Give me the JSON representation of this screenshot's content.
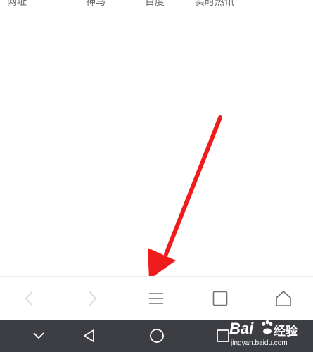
{
  "shortcuts": [
    "网址",
    "神马",
    "百度",
    "实时热讯"
  ],
  "toolbar": {
    "back_icon": "chevron-left-icon",
    "forward_icon": "chevron-right-icon",
    "menu_icon": "menu-icon",
    "tabs_icon": "tabs-icon",
    "home_icon": "home-icon"
  },
  "nav_bar": {
    "collapse_icon": "chevron-down-icon",
    "back_icon": "triangle-back-icon",
    "home_icon": "circle-home-icon",
    "recent_icon": "square-recent-icon"
  },
  "watermark": {
    "brand": "Bai",
    "brand_suffix": "经验",
    "url": "jingyan.baidu.com"
  },
  "colors": {
    "arrow": "#ee1c1c",
    "nav_bar": "#3c3e44",
    "toolbar_icon": "#707070",
    "toolbar_icon_disabled": "#dcdcdc"
  }
}
